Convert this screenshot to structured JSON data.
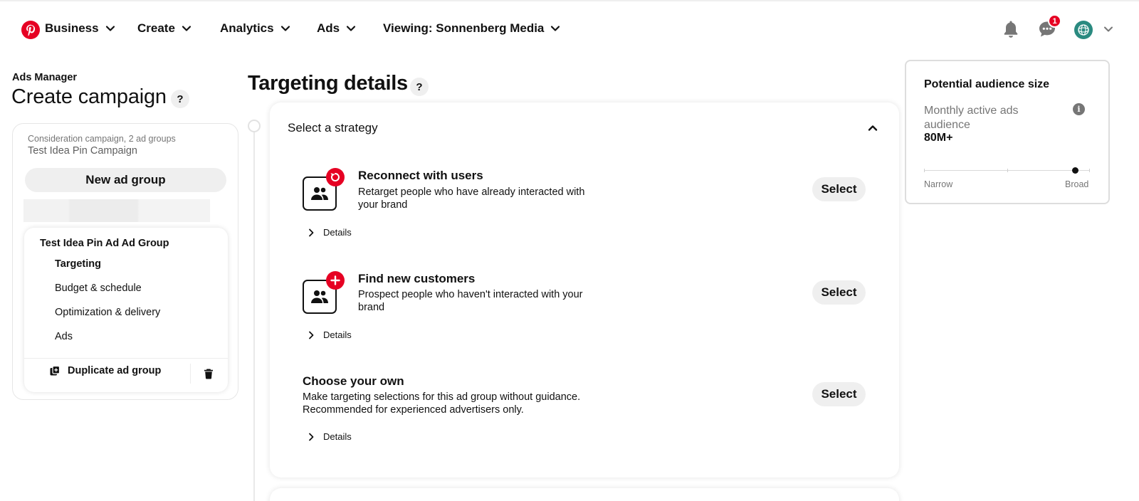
{
  "colors": {
    "brand": "#e60023",
    "avatar": "#2a8a80",
    "muted_text": "#767676",
    "pill_bg": "#efefef"
  },
  "topnav": {
    "logo": "pinterest-logo",
    "items": [
      {
        "label": "Business"
      },
      {
        "label": "Create"
      },
      {
        "label": "Analytics"
      },
      {
        "label": "Ads"
      },
      {
        "label": "Viewing: Sonnenberg Media"
      }
    ],
    "icons": {
      "notifications": "bell-icon",
      "messages": "chat-icon",
      "messages_badge": "1",
      "account": "avatar"
    }
  },
  "sidebar": {
    "section_label": "Ads Manager",
    "page_title": "Create campaign",
    "help": "?",
    "campaign": {
      "meta": "Consideration campaign, 2 ad groups",
      "name": "Test Idea Pin Campaign"
    },
    "new_ad_group_label": "New ad group",
    "ad_group": {
      "title": "Test Idea Pin Ad Ad Group",
      "links": [
        "Targeting",
        "Budget & schedule",
        "Optimization & delivery",
        "Ads"
      ],
      "active_link": "Targeting",
      "duplicate_label": "Duplicate ad group"
    }
  },
  "main": {
    "title": "Targeting details",
    "help": "?",
    "strategy_header": "Select a strategy",
    "options": [
      {
        "title": "Reconnect with users",
        "description": "Retarget people who have already interacted with your brand",
        "select_label": "Select",
        "details_label": "Details",
        "icon": "audience-icon",
        "badge_icon": "retarget-icon"
      },
      {
        "title": "Find new customers",
        "description": "Prospect people who haven't interacted with your brand",
        "select_label": "Select",
        "details_label": "Details",
        "icon": "audience-icon",
        "badge_icon": "plus-icon"
      },
      {
        "title": "Choose your own",
        "description": "Make targeting selections for this ad group without guidance. Recommended for experienced advertisers only.",
        "select_label": "Select",
        "details_label": "Details"
      }
    ]
  },
  "audience": {
    "title": "Potential audience size",
    "label": "Monthly active ads audience",
    "value": "80M+",
    "info": "i",
    "scale_min_label": "Narrow",
    "scale_max_label": "Broad",
    "scale_level": 0.91
  }
}
